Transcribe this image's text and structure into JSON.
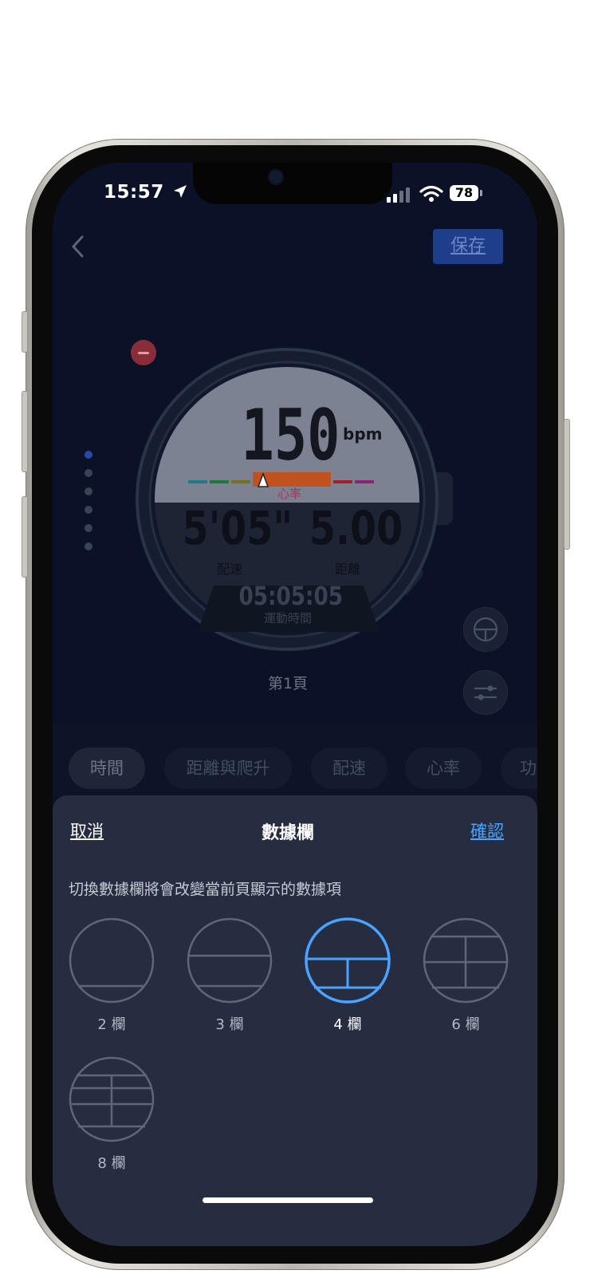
{
  "status_bar": {
    "time": "15:57",
    "battery": "78"
  },
  "header": {
    "save_label": "保存"
  },
  "watch": {
    "heart_rate_value": "150",
    "heart_rate_unit": "bpm",
    "heart_rate_label": "心率",
    "pace_value": "5'05\"",
    "pace_label": "配速",
    "distance_value": "5.00",
    "distance_label": "距離",
    "duration_value": "05:05:05",
    "duration_label": "運動時間"
  },
  "page_label": "第1頁",
  "category_tabs": [
    {
      "label": "時間",
      "active": true
    },
    {
      "label": "距離與爬升",
      "active": false
    },
    {
      "label": "配速",
      "active": false
    },
    {
      "label": "心率",
      "active": false
    },
    {
      "label": "功",
      "active": false
    }
  ],
  "sheet": {
    "cancel_label": "取消",
    "title": "數據欄",
    "confirm_label": "確認",
    "description": "切換數據欄將會改變當前頁顯示的數據項",
    "options": [
      {
        "label": "2 欄",
        "selected": false
      },
      {
        "label": "3 欄",
        "selected": false
      },
      {
        "label": "4 欄",
        "selected": true
      },
      {
        "label": "6 欄",
        "selected": false
      },
      {
        "label": "8 欄",
        "selected": false
      }
    ]
  },
  "colors": {
    "accent_blue": "#4aa3ff",
    "save_button": "#1e3d8a",
    "heart_zone_active": "#c0521f",
    "heart_label": "#b0305a"
  },
  "icons": [
    "location-arrow-icon",
    "signal-icon",
    "wifi-icon",
    "battery-icon",
    "back-chevron-icon",
    "watch-face-layout-icon",
    "sliders-icon",
    "remove-icon"
  ]
}
